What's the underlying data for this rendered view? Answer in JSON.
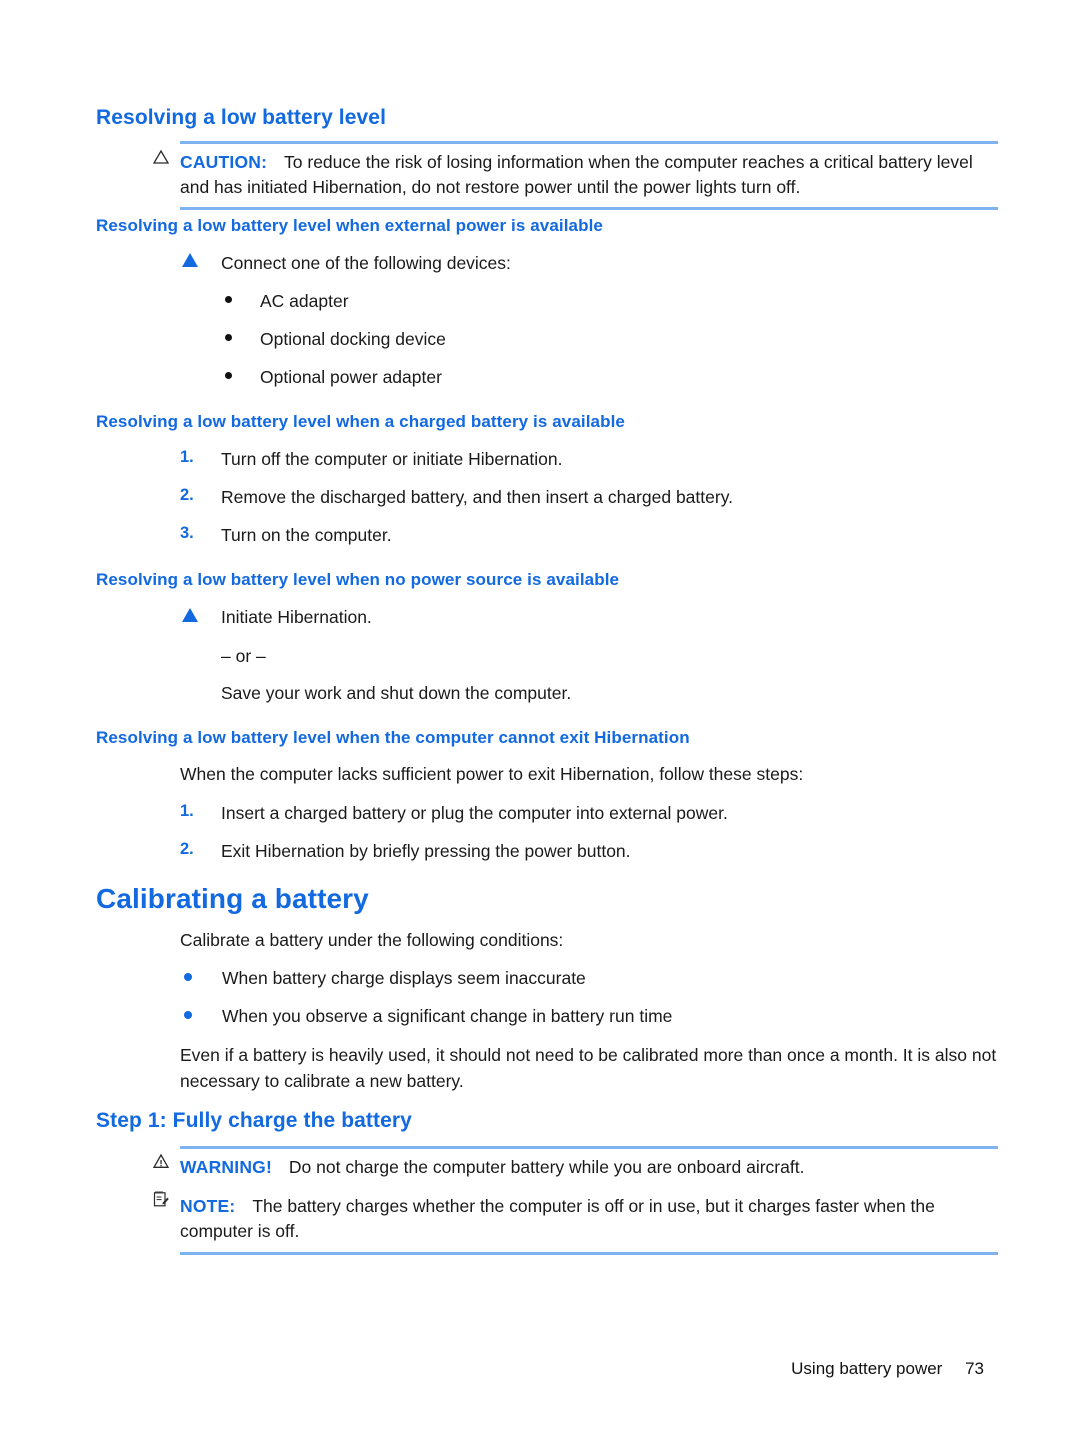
{
  "colors": {
    "heading_blue": "#1269E0",
    "rule_blue": "#7FB2F0",
    "body_black": "#1a1a1a"
  },
  "section_low_battery": {
    "heading": "Resolving a low battery level",
    "caution": {
      "icon": "caution-triangle-icon",
      "label": "CAUTION:",
      "text": "To reduce the risk of losing information when the computer reaches a critical battery level and has initiated Hibernation, do not restore power until the power lights turn off."
    },
    "sub_external_power": {
      "heading": "Resolving a low battery level when external power is available",
      "lead": "Connect one of the following devices:",
      "bullets": [
        "AC adapter",
        "Optional docking device",
        "Optional power adapter"
      ]
    },
    "sub_charged_battery": {
      "heading": "Resolving a low battery level when a charged battery is available",
      "steps": [
        {
          "num": "1.",
          "text": "Turn off the computer or initiate Hibernation."
        },
        {
          "num": "2.",
          "text": "Remove the discharged battery, and then insert a charged battery."
        },
        {
          "num": "3.",
          "text": "Turn on the computer."
        }
      ]
    },
    "sub_no_power": {
      "heading": "Resolving a low battery level when no power source is available",
      "action": "Initiate Hibernation.",
      "or_text": "– or –",
      "alternative": "Save your work and shut down the computer."
    },
    "sub_cannot_exit": {
      "heading": "Resolving a low battery level when the computer cannot exit Hibernation",
      "lead": "When the computer lacks sufficient power to exit Hibernation, follow these steps:",
      "steps": [
        {
          "num": "1.",
          "text": "Insert a charged battery or plug the computer into external power."
        },
        {
          "num": "2.",
          "text": "Exit Hibernation by briefly pressing the power button."
        }
      ]
    }
  },
  "section_calibrating": {
    "heading": "Calibrating a battery",
    "lead": "Calibrate a battery under the following conditions:",
    "bullets": [
      "When battery charge displays seem inaccurate",
      "When you observe a significant change in battery run time"
    ],
    "paragraph": "Even if a battery is heavily used, it should not need to be calibrated more than once a month. It is also not necessary to calibrate a new battery.",
    "step1": {
      "heading": "Step 1: Fully charge the battery",
      "warning": {
        "icon": "warning-triangle-icon",
        "label": "WARNING!",
        "text": "Do not charge the computer battery while you are onboard aircraft."
      },
      "note": {
        "icon": "note-pad-icon",
        "label": "NOTE:",
        "text": "The battery charges whether the computer is off or in use, but it charges faster when the computer is off."
      }
    }
  },
  "footer": {
    "title": "Using battery power",
    "page_number": "73"
  }
}
